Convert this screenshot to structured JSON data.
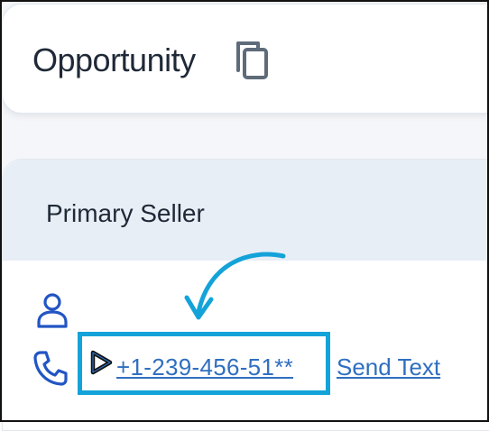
{
  "header": {
    "title": "Opportunity",
    "copy_icon": "copy-icon"
  },
  "section": {
    "title": "Primary Seller",
    "contact": {
      "person_icon": "person-icon",
      "phone_icon": "phone-icon",
      "call_icon": "play-icon",
      "phone_number": "+1-239-456-51**",
      "send_text_label": "Send Text"
    }
  },
  "annotation": {
    "arrow_color": "#14a3d9",
    "highlight_color": "#14a3d9"
  },
  "colors": {
    "link": "#2f6fc0",
    "icon": "#2255c4",
    "title_text": "#1f2937",
    "header_bg": "#e8eef5"
  }
}
